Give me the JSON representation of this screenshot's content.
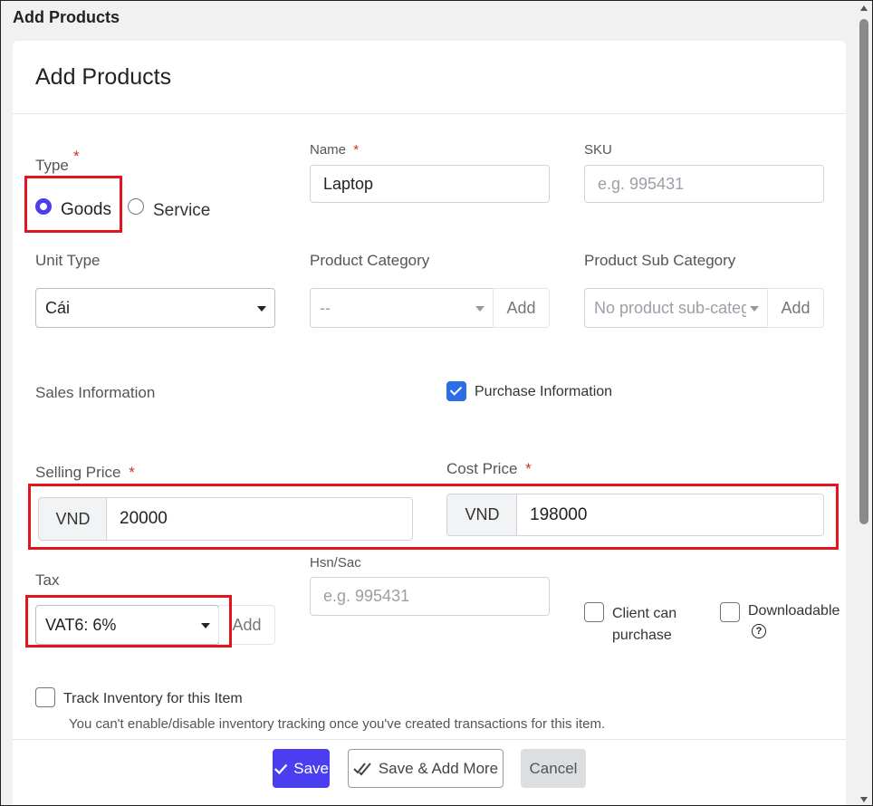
{
  "window": {
    "title": "Add Products"
  },
  "modal": {
    "title": "Add Products"
  },
  "type_field": {
    "label": "Type",
    "required_mark": "*",
    "options": [
      {
        "label": "Goods",
        "selected": true
      },
      {
        "label": "Service",
        "selected": false
      }
    ]
  },
  "name_field": {
    "label": "Name",
    "required_mark": "*",
    "value": "Laptop"
  },
  "sku_field": {
    "label": "SKU",
    "placeholder": "e.g. 995431"
  },
  "unit_type": {
    "label": "Unit Type",
    "value": "Cái"
  },
  "product_category": {
    "label": "Product Category",
    "value": "--",
    "add_label": "Add"
  },
  "product_sub_category": {
    "label": "Product Sub Category",
    "value": "No product sub-categ",
    "add_label": "Add"
  },
  "sales_information": {
    "label": "Sales Information"
  },
  "purchase_information": {
    "label": "Purchase Information",
    "checked": true
  },
  "selling_price": {
    "label": "Selling Price",
    "required_mark": "*",
    "currency": "VND",
    "value": "20000"
  },
  "cost_price": {
    "label": "Cost Price",
    "required_mark": "*",
    "currency": "VND",
    "value": "198000"
  },
  "tax": {
    "label": "Tax",
    "value": "VAT6: 6%",
    "add_label": "Add"
  },
  "hsn_sac": {
    "label": "Hsn/Sac",
    "placeholder": "e.g. 995431"
  },
  "client_can_purchase": {
    "label_line1": "Client can",
    "label_line2": "purchase",
    "checked": false
  },
  "downloadable": {
    "label": "Downloadable",
    "help_icon": "?",
    "checked": false
  },
  "track_inventory": {
    "label": "Track Inventory for this Item",
    "note": "You can't enable/disable inventory tracking once you've created transactions for this item.",
    "checked": false
  },
  "footer": {
    "save_label": "Save",
    "save_add_more_label": "Save & Add More",
    "cancel_label": "Cancel"
  },
  "colors": {
    "primary": "#4a3ef0",
    "checkbox_on": "#2a6ee8",
    "highlight_box": "#e3141b",
    "required": "#d32f2f"
  }
}
